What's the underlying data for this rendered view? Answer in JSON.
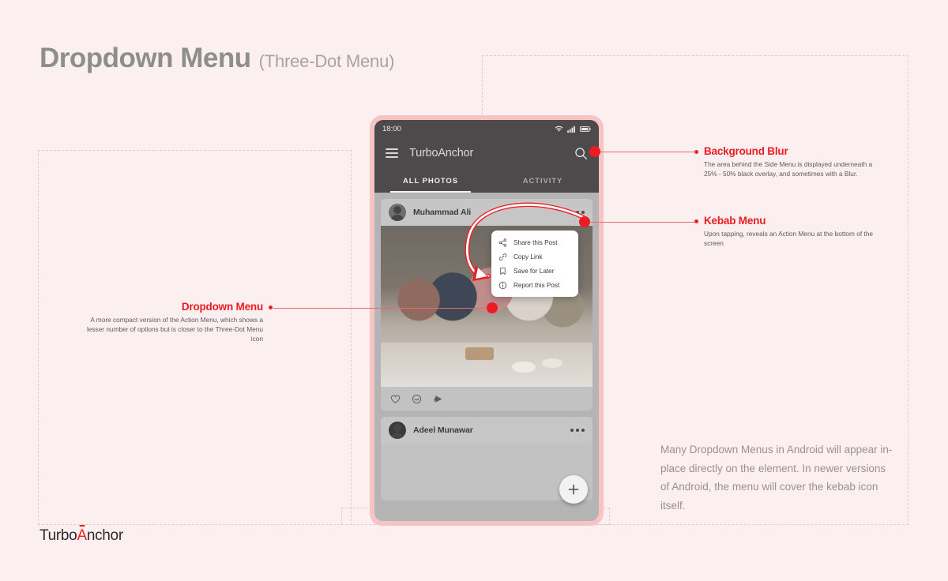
{
  "page": {
    "title_main": "Dropdown Menu",
    "title_sub": "(Three-Dot Menu)",
    "background_color": "#FCEFEF",
    "accent_color": "#ED1C24",
    "note_paragraph": "Many Dropdown Menus in Android will appear in-place directly on the element. In newer versions of Android, the menu will cover the kebab icon itself."
  },
  "logo": {
    "part1": "Turbo",
    "accent": "A",
    "part2": "nchor"
  },
  "phone": {
    "status_bar": {
      "time": "18:00",
      "icons": [
        "wifi-icon",
        "signal-icon",
        "battery-icon"
      ]
    },
    "app_bar": {
      "menu_icon": "hamburger-icon",
      "title": "TurboAnchor",
      "search_icon": "search-icon"
    },
    "tabs": [
      {
        "label": "ALL PHOTOS",
        "active": true
      },
      {
        "label": "ACTIVITY",
        "active": false
      }
    ],
    "posts": [
      {
        "author": "Muhammad Ali",
        "kebab_icon": "kebab-menu-icon",
        "actions": [
          "heart-icon",
          "comment-icon",
          "share-icon"
        ]
      },
      {
        "author": "Adeel Munawar",
        "kebab_icon": "kebab-menu-icon"
      }
    ],
    "fab": {
      "icon": "plus-icon",
      "label": "+"
    }
  },
  "dropdown_menu": {
    "items": [
      {
        "label": "Share this Post",
        "icon": "share-nodes-icon"
      },
      {
        "label": "Copy Link",
        "icon": "link-icon"
      },
      {
        "label": "Save for Later",
        "icon": "bookmark-icon"
      },
      {
        "label": "Report this Post",
        "icon": "report-info-icon"
      }
    ]
  },
  "annotations": [
    {
      "key": "background_blur",
      "title": "Background Blur",
      "body": "The area behind the Side Menu is displayed underneath a 25% - 50% black overlay, and sometimes with a Blur."
    },
    {
      "key": "kebab_menu",
      "title": "Kebab Menu",
      "body": "Upon tapping, reveals an Action Menu at the bottom of the screen"
    },
    {
      "key": "dropdown_menu",
      "title": "Dropdown Menu",
      "body": "A more compact version of the Action Menu, which shows a lesser number of options but is closer to the Three-Dot Menu icon"
    }
  ]
}
